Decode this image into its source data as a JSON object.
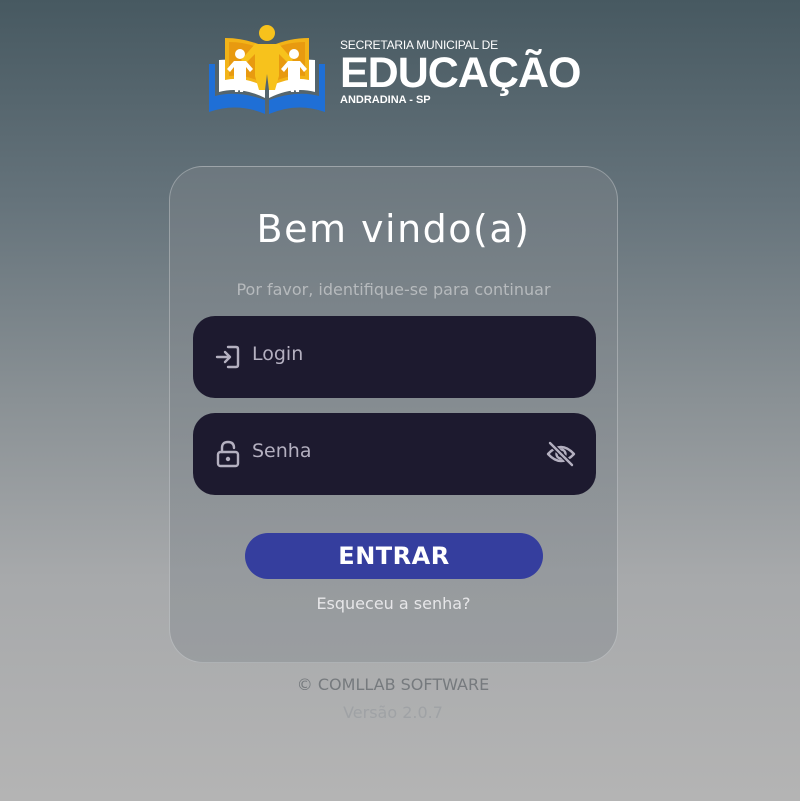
{
  "logo": {
    "line1": "SECRETARIA MUNICIPAL DE",
    "line2": "EDUCAÇÃO",
    "line3": "ANDRADINA - SP"
  },
  "card": {
    "title": "Bem vindo(a)",
    "subtitle": "Por favor, identifique-se para continuar",
    "login": {
      "placeholder": "Login",
      "value": "",
      "icon": "login-icon"
    },
    "password": {
      "placeholder": "Senha",
      "value": "",
      "icon": "lock-icon",
      "toggle_icon": "eye-off-icon"
    },
    "submit_label": "ENTRAR",
    "forgot_label": "Esqueceu a senha?"
  },
  "footer": {
    "copyright": "© COMLLAB SOFTWARE",
    "version": "Versão 2.0.7"
  },
  "colors": {
    "field_bg": "#1d1a2f",
    "button_bg": "#353e9e",
    "logo_book_blue": "#1f6fd6",
    "logo_figure_yellow": "#f2b318"
  }
}
